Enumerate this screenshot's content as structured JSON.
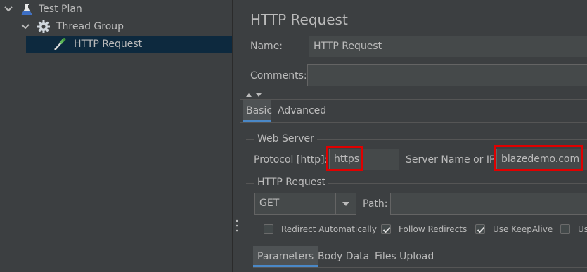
{
  "tree": {
    "items": [
      {
        "label": "Test Plan",
        "icon": "flask-icon"
      },
      {
        "label": "Thread Group",
        "icon": "gear-icon"
      },
      {
        "label": "HTTP Request",
        "icon": "dropper-icon"
      }
    ]
  },
  "panel": {
    "title": "HTTP Request",
    "name_label": "Name:",
    "name_value": "HTTP Request",
    "comments_label": "Comments:",
    "comments_value": "",
    "tabs": [
      {
        "label": "Basic",
        "active": true
      },
      {
        "label": "Advanced",
        "active": false
      }
    ],
    "web_server": {
      "section_label": "Web Server",
      "protocol_label": "Protocol [http]:",
      "protocol_value": "https",
      "server_label": "Server Name or IP:",
      "server_value": "blazedemo.com"
    },
    "http_request": {
      "section_label": "HTTP Request",
      "method_value": "GET",
      "path_label": "Path:",
      "path_value": ""
    },
    "options": [
      {
        "label": "Redirect Automatically",
        "checked": false
      },
      {
        "label": "Follow Redirects",
        "checked": true
      },
      {
        "label": "Use KeepAlive",
        "checked": true
      },
      {
        "label": "Us",
        "checked": false
      }
    ],
    "sub_tabs": [
      {
        "label": "Parameters",
        "active": true
      },
      {
        "label": "Body Data",
        "active": false
      },
      {
        "label": "Files Upload",
        "active": false
      }
    ]
  },
  "colors": {
    "background": "#3c3f41",
    "field": "#45494a",
    "selection": "#0d293e",
    "highlight_box": "#e00000",
    "tab_underline": "#4a88c7"
  }
}
